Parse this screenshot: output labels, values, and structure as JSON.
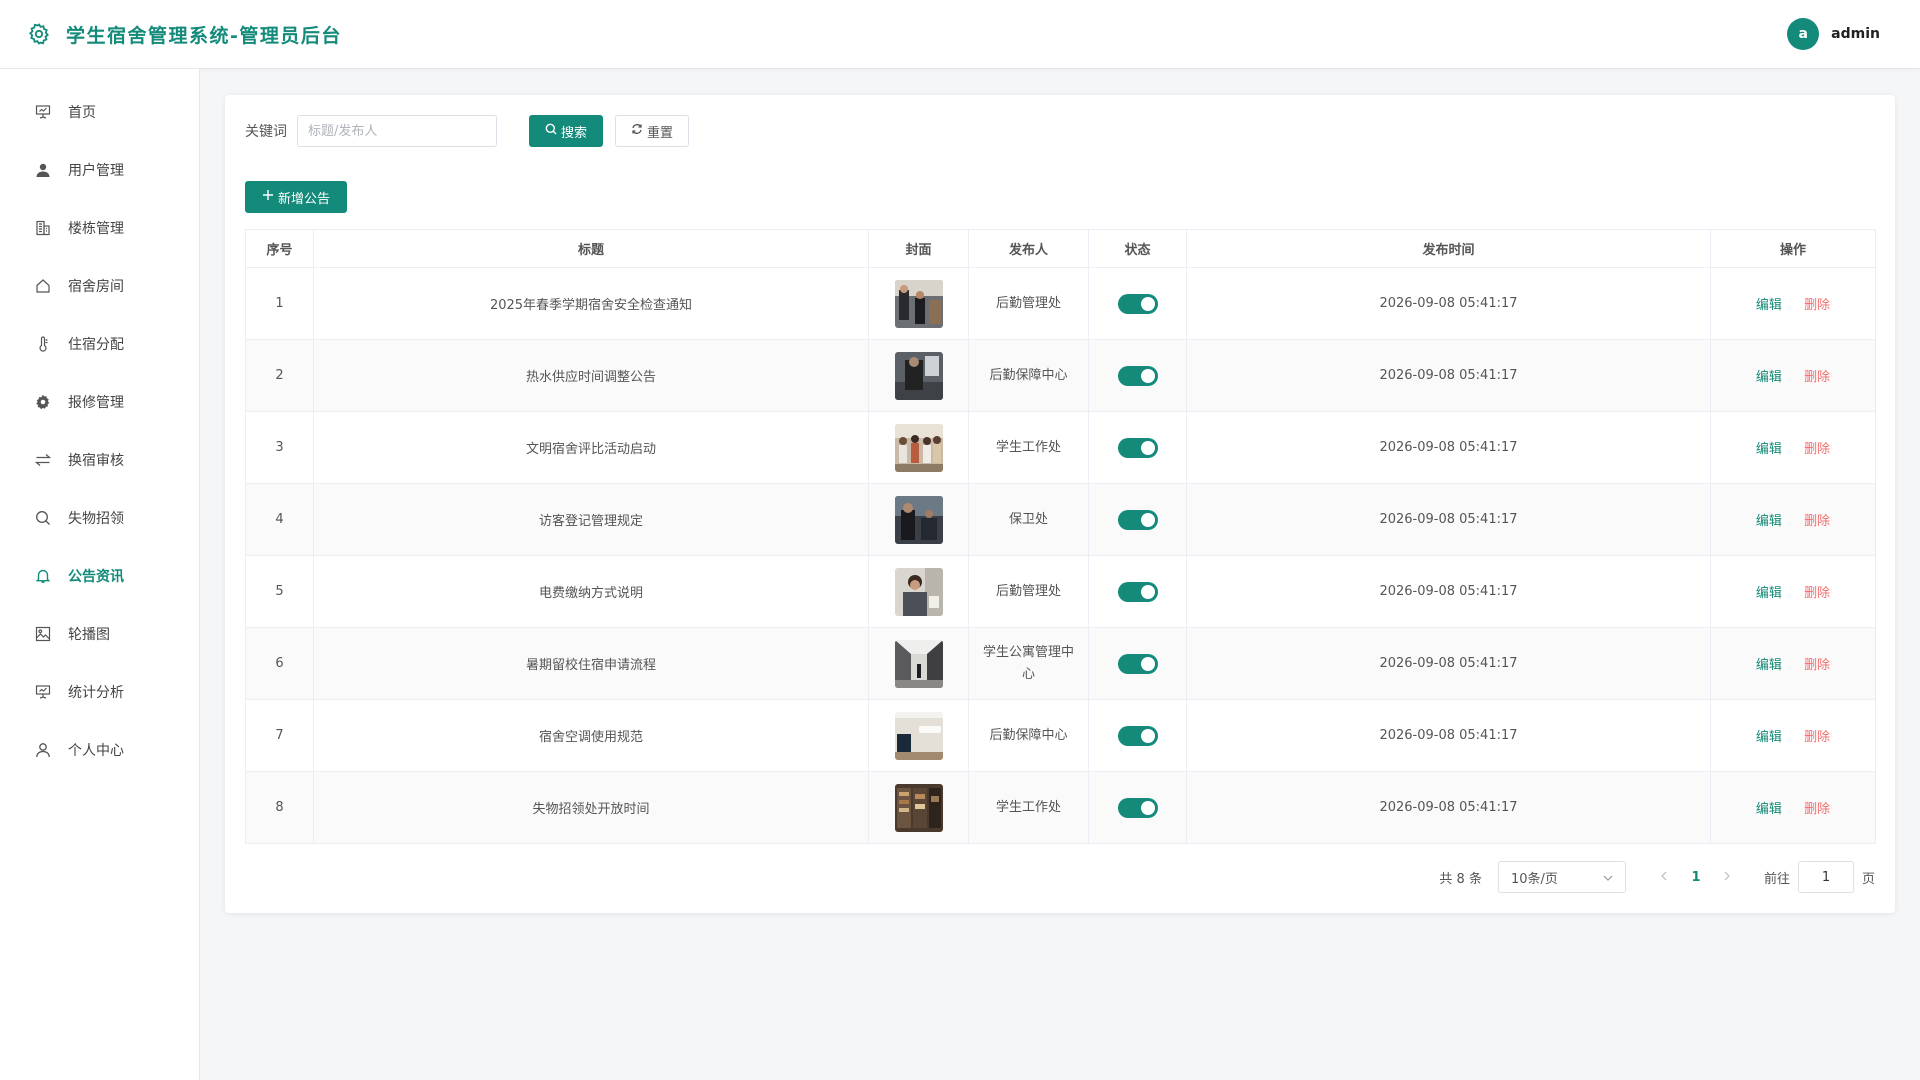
{
  "app": {
    "title": "学生宿舍管理系统-管理员后台"
  },
  "user": {
    "avatar_letter": "a",
    "name": "admin"
  },
  "colors": {
    "accent": "#138a7a",
    "danger": "#f56c6c"
  },
  "sidebar": {
    "items": [
      {
        "label": "首页",
        "icon": "presentation-icon"
      },
      {
        "label": "用户管理",
        "icon": "user-icon"
      },
      {
        "label": "楼栋管理",
        "icon": "building-icon"
      },
      {
        "label": "宿舍房间",
        "icon": "house-icon"
      },
      {
        "label": "住宿分配",
        "icon": "thermometer-icon"
      },
      {
        "label": "报修管理",
        "icon": "gear-icon"
      },
      {
        "label": "换宿审核",
        "icon": "switch-icon"
      },
      {
        "label": "失物招领",
        "icon": "search-icon"
      },
      {
        "label": "公告资讯",
        "icon": "bell-icon",
        "active": true
      },
      {
        "label": "轮播图",
        "icon": "picture-icon"
      },
      {
        "label": "统计分析",
        "icon": "chart-icon"
      },
      {
        "label": "个人中心",
        "icon": "user-outline-icon"
      }
    ]
  },
  "search": {
    "label": "关键词",
    "placeholder": "标题/发布人",
    "value": "",
    "search_btn": "搜索",
    "reset_btn": "重置"
  },
  "toolbar": {
    "add_btn": "新增公告"
  },
  "table": {
    "headers": [
      "序号",
      "标题",
      "封面",
      "发布人",
      "状态",
      "发布时间",
      "操作"
    ],
    "edit_label": "编辑",
    "delete_label": "删除",
    "rows": [
      {
        "no": "1",
        "title": "2025年春季学期宿舍安全检查通知",
        "publisher": "后勤管理处",
        "status": true,
        "time": "2026-09-08 05:41:17"
      },
      {
        "no": "2",
        "title": "热水供应时间调整公告",
        "publisher": "后勤保障中心",
        "status": true,
        "time": "2026-09-08 05:41:17"
      },
      {
        "no": "3",
        "title": "文明宿舍评比活动启动",
        "publisher": "学生工作处",
        "status": true,
        "time": "2026-09-08 05:41:17"
      },
      {
        "no": "4",
        "title": "访客登记管理规定",
        "publisher": "保卫处",
        "status": true,
        "time": "2026-09-08 05:41:17"
      },
      {
        "no": "5",
        "title": "电费缴纳方式说明",
        "publisher": "后勤管理处",
        "status": true,
        "time": "2026-09-08 05:41:17"
      },
      {
        "no": "6",
        "title": "暑期留校住宿申请流程",
        "publisher": "学生公寓管理中心",
        "status": true,
        "time": "2026-09-08 05:41:17"
      },
      {
        "no": "7",
        "title": "宿舍空调使用规范",
        "publisher": "后勤保障中心",
        "status": true,
        "time": "2026-09-08 05:41:17"
      },
      {
        "no": "8",
        "title": "失物招领处开放时间",
        "publisher": "学生工作处",
        "status": true,
        "time": "2026-09-08 05:41:17"
      }
    ]
  },
  "pagination": {
    "total": "共 8 条",
    "page_size": "10条/页",
    "current": "1",
    "goto_label": "前往",
    "goto_value": "1",
    "goto_suffix": "页"
  }
}
